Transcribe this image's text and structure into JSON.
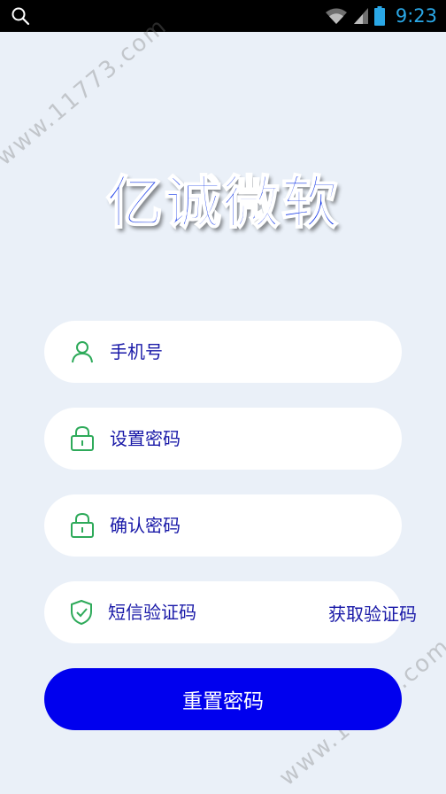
{
  "status_bar": {
    "time": "9:23",
    "icons": [
      "search-icon",
      "wifi-icon",
      "signal-icon",
      "battery-icon"
    ]
  },
  "watermark": {
    "text_top": "www.11773.com",
    "text_bottom": "www.11773.com"
  },
  "logo": {
    "text": "亿诚微软"
  },
  "form": {
    "phone_placeholder": "手机号",
    "password_placeholder": "设置密码",
    "confirm_placeholder": "确认密码",
    "sms_placeholder": "短信验证码",
    "get_code_label": "获取验证码",
    "submit_label": "重置密码"
  },
  "colors": {
    "background": "#eaf0f8",
    "accent_blue": "#0000ee",
    "text_blue": "#1a1aa8",
    "icon_green": "#2eaa5a",
    "status_blue": "#2aa7e6"
  }
}
